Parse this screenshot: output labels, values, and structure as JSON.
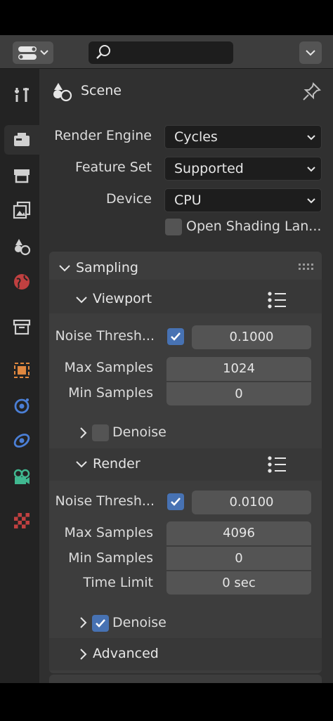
{
  "context": {
    "label": "Scene"
  },
  "render_engine": {
    "label": "Render Engine",
    "value": "Cycles"
  },
  "feature_set": {
    "label": "Feature Set",
    "value": "Supported"
  },
  "device": {
    "label": "Device",
    "value": "CPU"
  },
  "open_shading": {
    "label": "Open Shading Lan...",
    "checked": false
  },
  "sampling": {
    "title": "Sampling",
    "viewport": {
      "title": "Viewport",
      "noise_threshold": {
        "label": "Noise Thresh...",
        "checked": true,
        "value": "0.1000"
      },
      "max_samples": {
        "label": "Max Samples",
        "value": "1024"
      },
      "min_samples": {
        "label": "Min Samples",
        "value": "0"
      },
      "denoise": {
        "label": "Denoise",
        "checked": false
      }
    },
    "render": {
      "title": "Render",
      "noise_threshold": {
        "label": "Noise Thresh...",
        "checked": true,
        "value": "0.0100"
      },
      "max_samples": {
        "label": "Max Samples",
        "value": "4096"
      },
      "min_samples": {
        "label": "Min Samples",
        "value": "0"
      },
      "time_limit": {
        "label": "Time Limit",
        "value": "0 sec"
      },
      "denoise": {
        "label": "Denoise",
        "checked": true
      }
    },
    "advanced": {
      "title": "Advanced"
    }
  },
  "tabs": [
    "tool",
    "render",
    "output",
    "view-layer",
    "scene",
    "world",
    "collection",
    "object",
    "modifiers",
    "particles",
    "physics",
    "constraints",
    "data",
    "texture"
  ],
  "colors": {
    "accent": "#4772b3",
    "panel": "#3d3d3d",
    "background": "#303030"
  }
}
